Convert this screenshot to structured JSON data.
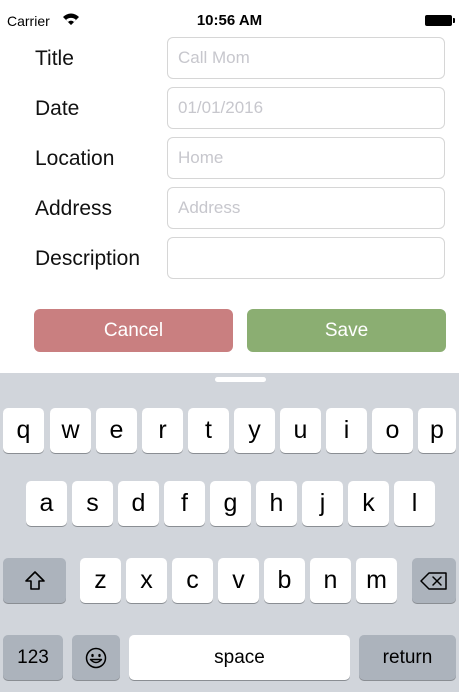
{
  "status_bar": {
    "carrier": "Carrier",
    "time": "10:56 AM"
  },
  "form": {
    "fields": [
      {
        "label": "Title",
        "value": "",
        "placeholder": "Call Mom"
      },
      {
        "label": "Date",
        "value": "",
        "placeholder": "01/01/2016"
      },
      {
        "label": "Location",
        "value": "",
        "placeholder": "Home"
      },
      {
        "label": "Address",
        "value": "",
        "placeholder": "Address"
      },
      {
        "label": "Description",
        "value": "",
        "placeholder": ""
      }
    ],
    "cancel_label": "Cancel",
    "save_label": "Save",
    "colors": {
      "cancel": "#c97f80",
      "save": "#8bae72"
    }
  },
  "keyboard": {
    "row1": [
      "q",
      "w",
      "e",
      "r",
      "t",
      "y",
      "u",
      "i",
      "o",
      "p"
    ],
    "row2": [
      "a",
      "s",
      "d",
      "f",
      "g",
      "h",
      "j",
      "k",
      "l"
    ],
    "row3": [
      "z",
      "x",
      "c",
      "v",
      "b",
      "n",
      "m"
    ],
    "shift_icon": "shift-icon",
    "delete_icon": "backspace-icon",
    "numbers_label": "123",
    "emoji_icon": "emoji-icon",
    "space_label": "space",
    "return_label": "return"
  }
}
